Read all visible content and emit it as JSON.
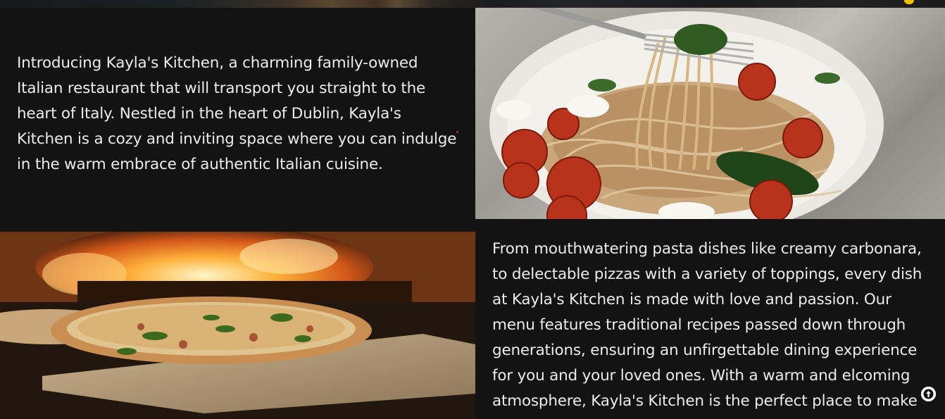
{
  "intro": {
    "paragraph": "Introducing Kayla's Kitchen, a charming family-owned Italian restaurant that will transport you straight to the heart of Italy. Nestled in the heart of Dublin, Kayla's Kitchen is a cozy and inviting space where you can indulge in the warm embrace of authentic Italian cuisine."
  },
  "description": {
    "paragraph": "From mouthwatering pasta dishes like creamy carbonara, to delectable pizzas with a variety of toppings, every dish at Kayla's Kitchen is made with love and passion. Our menu features traditional recipes passed down through generations, ensuring an unfirgettable dining experience for you and your loved ones. With a warm and elcoming atmosphere, Kayla's Kitchen is the perfect place to make lasting memories while"
  },
  "images": {
    "pasta": "pasta-photo",
    "pizza": "pizza-photo"
  },
  "controls": {
    "scroll_top_icon": "arrow-up-icon"
  },
  "colors": {
    "background": "#131313",
    "text": "#ececec",
    "accent": "#f2c200",
    "red_dot": "#d31b1b"
  }
}
